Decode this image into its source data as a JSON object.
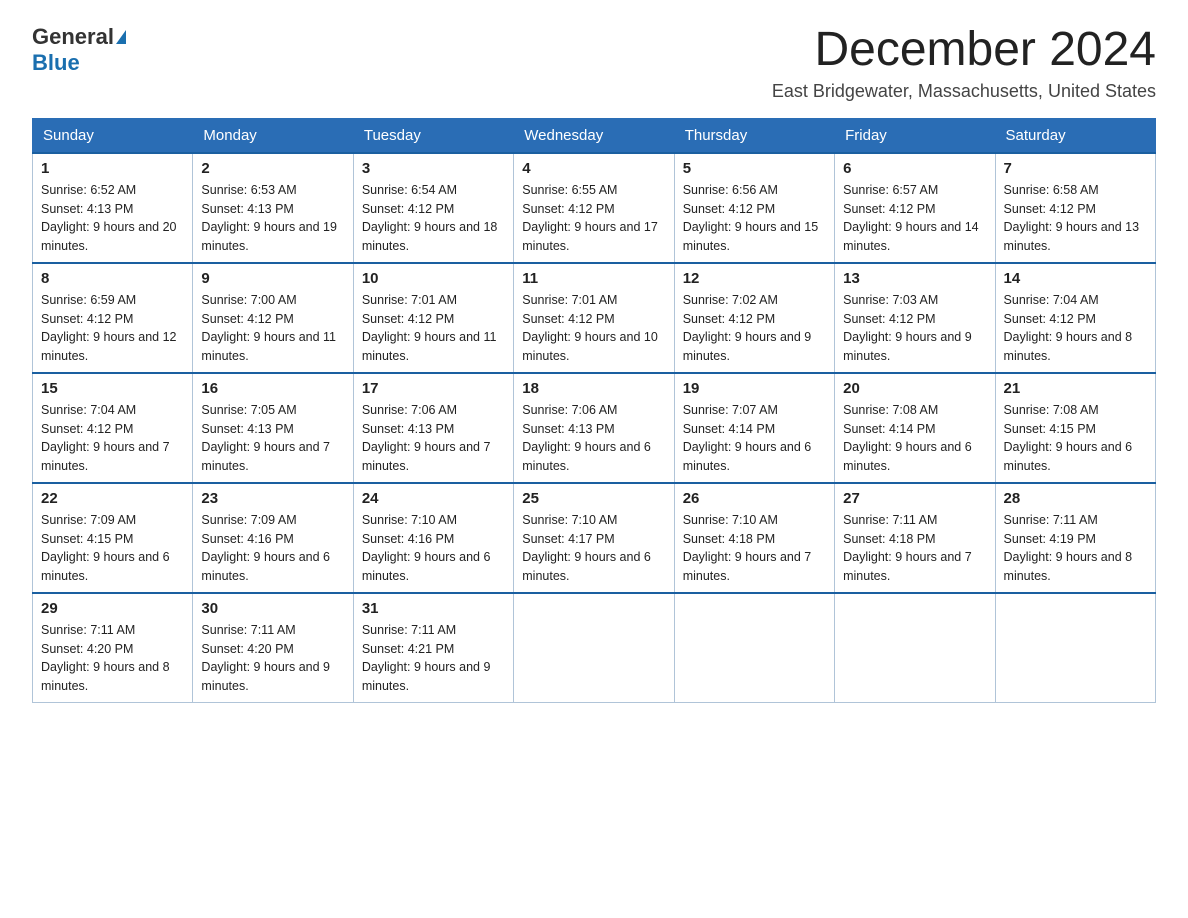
{
  "logo": {
    "general": "General",
    "blue": "Blue"
  },
  "title": "December 2024",
  "subtitle": "East Bridgewater, Massachusetts, United States",
  "weekdays": [
    "Sunday",
    "Monday",
    "Tuesday",
    "Wednesday",
    "Thursday",
    "Friday",
    "Saturday"
  ],
  "weeks": [
    [
      {
        "day": "1",
        "sunrise": "6:52 AM",
        "sunset": "4:13 PM",
        "daylight": "9 hours and 20 minutes."
      },
      {
        "day": "2",
        "sunrise": "6:53 AM",
        "sunset": "4:13 PM",
        "daylight": "9 hours and 19 minutes."
      },
      {
        "day": "3",
        "sunrise": "6:54 AM",
        "sunset": "4:12 PM",
        "daylight": "9 hours and 18 minutes."
      },
      {
        "day": "4",
        "sunrise": "6:55 AM",
        "sunset": "4:12 PM",
        "daylight": "9 hours and 17 minutes."
      },
      {
        "day": "5",
        "sunrise": "6:56 AM",
        "sunset": "4:12 PM",
        "daylight": "9 hours and 15 minutes."
      },
      {
        "day": "6",
        "sunrise": "6:57 AM",
        "sunset": "4:12 PM",
        "daylight": "9 hours and 14 minutes."
      },
      {
        "day": "7",
        "sunrise": "6:58 AM",
        "sunset": "4:12 PM",
        "daylight": "9 hours and 13 minutes."
      }
    ],
    [
      {
        "day": "8",
        "sunrise": "6:59 AM",
        "sunset": "4:12 PM",
        "daylight": "9 hours and 12 minutes."
      },
      {
        "day": "9",
        "sunrise": "7:00 AM",
        "sunset": "4:12 PM",
        "daylight": "9 hours and 11 minutes."
      },
      {
        "day": "10",
        "sunrise": "7:01 AM",
        "sunset": "4:12 PM",
        "daylight": "9 hours and 11 minutes."
      },
      {
        "day": "11",
        "sunrise": "7:01 AM",
        "sunset": "4:12 PM",
        "daylight": "9 hours and 10 minutes."
      },
      {
        "day": "12",
        "sunrise": "7:02 AM",
        "sunset": "4:12 PM",
        "daylight": "9 hours and 9 minutes."
      },
      {
        "day": "13",
        "sunrise": "7:03 AM",
        "sunset": "4:12 PM",
        "daylight": "9 hours and 9 minutes."
      },
      {
        "day": "14",
        "sunrise": "7:04 AM",
        "sunset": "4:12 PM",
        "daylight": "9 hours and 8 minutes."
      }
    ],
    [
      {
        "day": "15",
        "sunrise": "7:04 AM",
        "sunset": "4:12 PM",
        "daylight": "9 hours and 7 minutes."
      },
      {
        "day": "16",
        "sunrise": "7:05 AM",
        "sunset": "4:13 PM",
        "daylight": "9 hours and 7 minutes."
      },
      {
        "day": "17",
        "sunrise": "7:06 AM",
        "sunset": "4:13 PM",
        "daylight": "9 hours and 7 minutes."
      },
      {
        "day": "18",
        "sunrise": "7:06 AM",
        "sunset": "4:13 PM",
        "daylight": "9 hours and 6 minutes."
      },
      {
        "day": "19",
        "sunrise": "7:07 AM",
        "sunset": "4:14 PM",
        "daylight": "9 hours and 6 minutes."
      },
      {
        "day": "20",
        "sunrise": "7:08 AM",
        "sunset": "4:14 PM",
        "daylight": "9 hours and 6 minutes."
      },
      {
        "day": "21",
        "sunrise": "7:08 AM",
        "sunset": "4:15 PM",
        "daylight": "9 hours and 6 minutes."
      }
    ],
    [
      {
        "day": "22",
        "sunrise": "7:09 AM",
        "sunset": "4:15 PM",
        "daylight": "9 hours and 6 minutes."
      },
      {
        "day": "23",
        "sunrise": "7:09 AM",
        "sunset": "4:16 PM",
        "daylight": "9 hours and 6 minutes."
      },
      {
        "day": "24",
        "sunrise": "7:10 AM",
        "sunset": "4:16 PM",
        "daylight": "9 hours and 6 minutes."
      },
      {
        "day": "25",
        "sunrise": "7:10 AM",
        "sunset": "4:17 PM",
        "daylight": "9 hours and 6 minutes."
      },
      {
        "day": "26",
        "sunrise": "7:10 AM",
        "sunset": "4:18 PM",
        "daylight": "9 hours and 7 minutes."
      },
      {
        "day": "27",
        "sunrise": "7:11 AM",
        "sunset": "4:18 PM",
        "daylight": "9 hours and 7 minutes."
      },
      {
        "day": "28",
        "sunrise": "7:11 AM",
        "sunset": "4:19 PM",
        "daylight": "9 hours and 8 minutes."
      }
    ],
    [
      {
        "day": "29",
        "sunrise": "7:11 AM",
        "sunset": "4:20 PM",
        "daylight": "9 hours and 8 minutes."
      },
      {
        "day": "30",
        "sunrise": "7:11 AM",
        "sunset": "4:20 PM",
        "daylight": "9 hours and 9 minutes."
      },
      {
        "day": "31",
        "sunrise": "7:11 AM",
        "sunset": "4:21 PM",
        "daylight": "9 hours and 9 minutes."
      },
      null,
      null,
      null,
      null
    ]
  ]
}
